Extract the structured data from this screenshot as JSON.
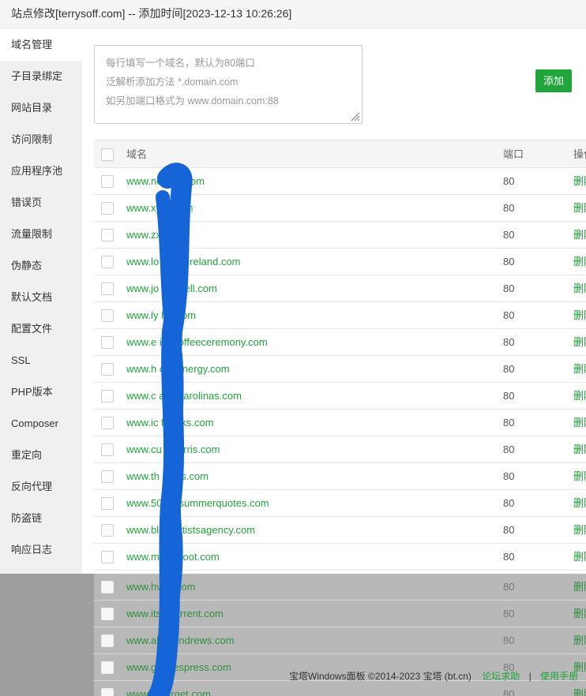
{
  "window": {
    "title": "站点修改[terrysoff.com] -- 添加时间[2023-12-13 10:26:26]"
  },
  "sidebar": {
    "items": [
      {
        "label": "域名管理"
      },
      {
        "label": "子目录绑定"
      },
      {
        "label": "网站目录"
      },
      {
        "label": "访问限制"
      },
      {
        "label": "应用程序池"
      },
      {
        "label": "错误页"
      },
      {
        "label": "流量限制"
      },
      {
        "label": "伪静态"
      },
      {
        "label": "默认文档"
      },
      {
        "label": "配置文件"
      },
      {
        "label": "SSL"
      },
      {
        "label": "PHP版本"
      },
      {
        "label": "Composer"
      },
      {
        "label": "重定向"
      },
      {
        "label": "反向代理"
      },
      {
        "label": "防盗链"
      },
      {
        "label": "响应日志"
      }
    ],
    "active_index": 0
  },
  "domain_input": {
    "placeholder_lines": [
      "每行填写一个域名，默认为80端口",
      "泛解析添加方法 *.domain.com",
      "如另加端口格式为 www.domain.com:88"
    ],
    "value": ""
  },
  "add_button": {
    "label": "添加"
  },
  "table": {
    "headers": {
      "domain": "域名",
      "port": "端口",
      "operation": "操作"
    },
    "rows": [
      {
        "domain": "www.ne        nnd.com",
        "port": "80",
        "action": "删除"
      },
      {
        "domain": "www.xy        w.com",
        "port": "80",
        "action": "删除"
      },
      {
        "domain": "www.zx        com",
        "port": "80",
        "action": "删除"
      },
      {
        "domain": "www.lo        erapyireland.com",
        "port": "80",
        "action": "删除"
      },
      {
        "domain": "www.jo        marcell.com",
        "port": "80",
        "action": "删除"
      },
      {
        "domain": "www.ly        hill.com",
        "port": "80",
        "action": "删除"
      },
      {
        "domain": "www.e        iancoffeeceremony.com",
        "port": "80",
        "action": "删除"
      },
      {
        "domain": "www.h        olarenergy.com",
        "port": "80",
        "action": "删除"
      },
      {
        "domain": "www.c        aigncarolinas.com",
        "port": "80",
        "action": "删除"
      },
      {
        "domain": "www.ic        fbanks.com",
        "port": "80",
        "action": "删除"
      },
      {
        "domain": "www.cu        wharris.com",
        "port": "80",
        "action": "删除"
      },
      {
        "domain": "www.th        efiles.com",
        "port": "80",
        "action": "删除"
      },
      {
        "domain": "www.50        sofsummerquotes.com",
        "port": "80",
        "action": "删除"
      },
      {
        "domain": "www.bl        irdartistsagency.com",
        "port": "80",
        "action": "删除"
      },
      {
        "domain": "www.m        eanroot.com",
        "port": "80",
        "action": "删除"
      },
      {
        "domain": "www.hv        or.com",
        "port": "80",
        "action": "删除"
      },
      {
        "domain": "www.its        kcurrent.com",
        "port": "80",
        "action": "删除"
      },
      {
        "domain": "www.ab        standrews.com",
        "port": "80",
        "action": "删除"
      },
      {
        "domain": "www.gi        onespress.com",
        "port": "80",
        "action": "删除"
      },
      {
        "domain": "www.xr        target.com",
        "port": "80",
        "action": "删除"
      }
    ]
  },
  "footer": {
    "copyright": "宝塔Windows面板 ©2014-2023 宝塔 (bt.cn)",
    "forum_link": "论坛求助",
    "separator": "|",
    "manual_link": "使用手册"
  },
  "colors": {
    "accent_green": "#20a53a",
    "sidebar_bg": "#f0f0f0",
    "header_bg": "#f5f5f5",
    "redaction_blue": "#1565d8"
  }
}
